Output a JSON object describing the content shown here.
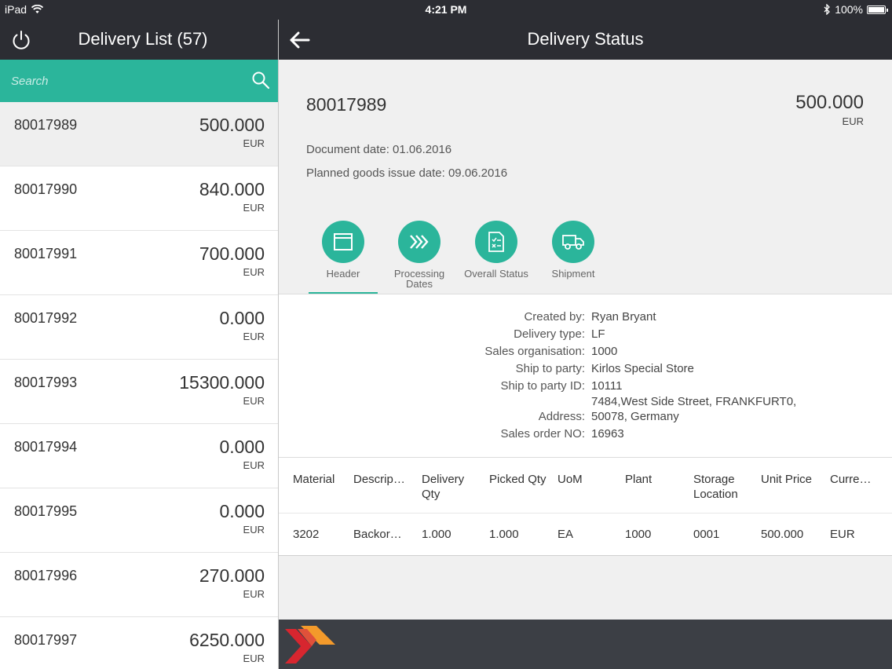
{
  "statusbar": {
    "device": "iPad",
    "time": "4:21 PM",
    "battery": "100%"
  },
  "left_panel": {
    "title": "Delivery List (57)",
    "search_placeholder": "Search",
    "items": [
      {
        "id": "80017989",
        "amount": "500.000",
        "currency": "EUR",
        "selected": true
      },
      {
        "id": "80017990",
        "amount": "840.000",
        "currency": "EUR"
      },
      {
        "id": "80017991",
        "amount": "700.000",
        "currency": "EUR"
      },
      {
        "id": "80017992",
        "amount": "0.000",
        "currency": "EUR"
      },
      {
        "id": "80017993",
        "amount": "15300.000",
        "currency": "EUR"
      },
      {
        "id": "80017994",
        "amount": "0.000",
        "currency": "EUR"
      },
      {
        "id": "80017995",
        "amount": "0.000",
        "currency": "EUR"
      },
      {
        "id": "80017996",
        "amount": "270.000",
        "currency": "EUR"
      },
      {
        "id": "80017997",
        "amount": "6250.000",
        "currency": "EUR"
      }
    ]
  },
  "right_panel": {
    "title": "Delivery Status",
    "document": {
      "id": "80017989",
      "amount": "500.000",
      "currency": "EUR",
      "document_date": "Document date: 01.06.2016",
      "planned_goods_issue": "Planned goods issue date: 09.06.2016"
    },
    "tabs": [
      {
        "label": "Header",
        "icon": "window-icon",
        "active": true
      },
      {
        "label": "Processing Dates",
        "icon": "chevrons-right-icon"
      },
      {
        "label": "Overall Status",
        "icon": "document-checklist-icon"
      },
      {
        "label": "Shipment",
        "icon": "truck-icon"
      }
    ],
    "details": [
      {
        "label": "Created by:",
        "value": "Ryan Bryant"
      },
      {
        "label": "Delivery type:",
        "value": "LF"
      },
      {
        "label": "Sales organisation:",
        "value": "1000"
      },
      {
        "label": "Ship to party:",
        "value": "Kirlos Special Store"
      },
      {
        "label": "Ship to party ID:",
        "value": "10111"
      },
      {
        "label": "Address:",
        "value_line1": "7484,West Side Street, FRANKFURT0,",
        "value_line2": "50078, Germany"
      },
      {
        "label": "Sales order NO:",
        "value": "16963"
      }
    ],
    "table": {
      "columns": [
        "Material",
        "Descrip…",
        "Delivery Qty",
        "Picked Qty",
        "UoM",
        "Plant",
        "Storage Location",
        "Unit Price",
        "Curre…"
      ],
      "rows": [
        [
          "3202",
          "Backor…",
          "1.000",
          "1.000",
          "EA",
          "1000",
          "0001",
          "500.000",
          "EUR"
        ]
      ]
    }
  },
  "colors": {
    "accent": "#2bb59b",
    "header": "#2c2d33",
    "footer": "#3c3f45",
    "logo_red": "#d7262f",
    "logo_orange": "#f39a2b"
  }
}
